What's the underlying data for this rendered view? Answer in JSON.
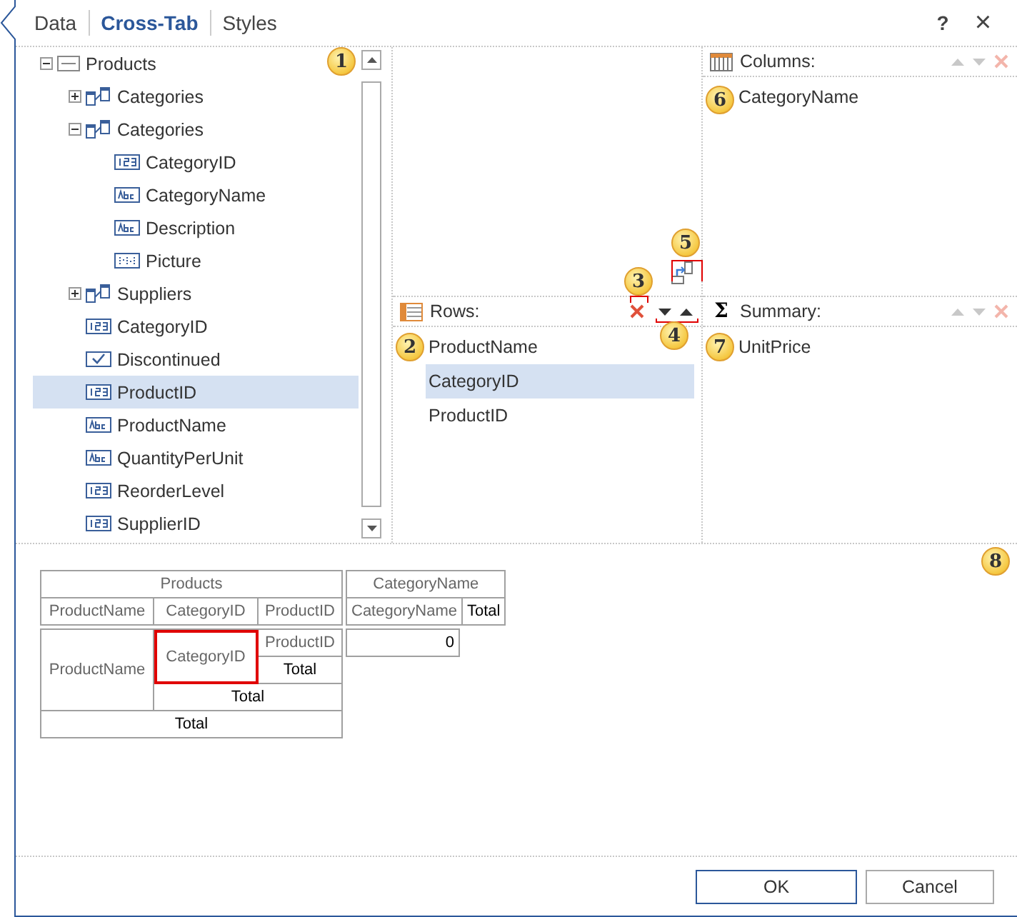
{
  "tabs": [
    {
      "label": "Data",
      "selected": false
    },
    {
      "label": "Cross-Tab",
      "selected": true
    },
    {
      "label": "Styles",
      "selected": false
    }
  ],
  "window_actions": {
    "help": "?",
    "close": "×"
  },
  "tree": {
    "items": [
      {
        "label": "Products",
        "kind": "table",
        "expanded": true,
        "selected": false,
        "children": [
          {
            "label": "Categories",
            "kind": "relation",
            "expanded": false,
            "selected": false
          },
          {
            "label": "Categories",
            "kind": "relation",
            "expanded": true,
            "selected": false,
            "children": [
              {
                "label": "CategoryID",
                "kind": "number",
                "selected": false
              },
              {
                "label": "CategoryName",
                "kind": "text",
                "selected": false
              },
              {
                "label": "Description",
                "kind": "text",
                "selected": false
              },
              {
                "label": "Picture",
                "kind": "image",
                "selected": false
              }
            ]
          },
          {
            "label": "Suppliers",
            "kind": "relation",
            "expanded": false,
            "selected": false
          },
          {
            "label": "CategoryID",
            "kind": "number",
            "selected": false
          },
          {
            "label": "Discontinued",
            "kind": "bool",
            "selected": false
          },
          {
            "label": "ProductID",
            "kind": "number",
            "selected": true
          },
          {
            "label": "ProductName",
            "kind": "text",
            "selected": false
          },
          {
            "label": "QuantityPerUnit",
            "kind": "text",
            "selected": false
          },
          {
            "label": "ReorderLevel",
            "kind": "number",
            "selected": false
          },
          {
            "label": "SupplierID",
            "kind": "number",
            "selected": false
          }
        ]
      }
    ]
  },
  "rows_panel": {
    "title": "Rows:",
    "controls_disabled": false,
    "items": [
      {
        "label": "ProductName",
        "selected": false
      },
      {
        "label": "CategoryID",
        "selected": true
      },
      {
        "label": "ProductID",
        "selected": false
      }
    ]
  },
  "columns_panel": {
    "title": "Columns:",
    "controls_disabled": true,
    "items": [
      {
        "label": "CategoryName",
        "selected": false
      }
    ]
  },
  "summary_panel": {
    "title": "Summary:",
    "symbol": "Σ",
    "controls_disabled": true,
    "items": [
      {
        "label": "UnitPrice",
        "selected": false
      }
    ]
  },
  "callouts": [
    "1",
    "2",
    "3",
    "4",
    "5",
    "6",
    "7",
    "8"
  ],
  "preview": {
    "row_area_title": "Products",
    "row_fields": [
      "ProductName",
      "CategoryID",
      "ProductID"
    ],
    "column_area_title": "CategoryName",
    "column_fields": [
      {
        "text": "CategoryName",
        "kind": "field"
      },
      {
        "text": "Total",
        "kind": "total"
      }
    ],
    "row_cells": [
      {
        "text": "ProductName",
        "kind": "field",
        "selected": false
      },
      {
        "text": "CategoryID",
        "kind": "field",
        "selected": true
      },
      {
        "text": "ProductID",
        "kind": "field",
        "selected": false
      },
      {
        "text": "Total",
        "kind": "total",
        "selected": false
      },
      {
        "text": "Total",
        "kind": "total",
        "selected": false
      },
      {
        "text": "Total",
        "kind": "total",
        "selected": false
      }
    ],
    "value": "0"
  },
  "buttons": [
    {
      "label": "OK",
      "kind": "primary"
    },
    {
      "label": "Cancel",
      "kind": "secondary"
    }
  ]
}
